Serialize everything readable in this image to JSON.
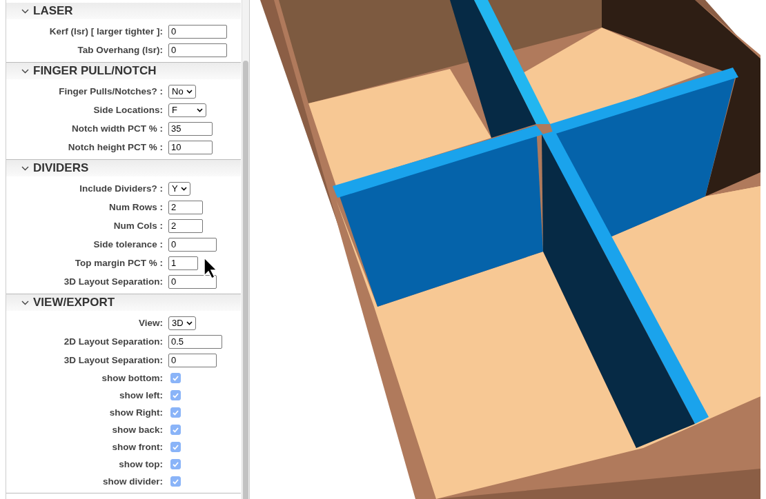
{
  "sections": [
    {
      "title": "LASER",
      "expanded": true,
      "fields": [
        {
          "kind": "text",
          "label": "Kerf (lsr) [ larger tighter ]:",
          "value": "0"
        },
        {
          "kind": "text",
          "label": "Tab Overhang (lsr):",
          "value": "0"
        }
      ]
    },
    {
      "title": "FINGER PULL/NOTCH",
      "expanded": true,
      "fields": [
        {
          "kind": "select",
          "label": "Finger Pulls/Notches? :",
          "value": "No"
        },
        {
          "kind": "select",
          "label": "Side Locations:",
          "value": "F"
        },
        {
          "kind": "text",
          "label": "Notch width PCT % :",
          "value": "35"
        },
        {
          "kind": "text",
          "label": "Notch height PCT % :",
          "value": "10"
        }
      ]
    },
    {
      "title": "DIVIDERS",
      "expanded": true,
      "fields": [
        {
          "kind": "select",
          "label": "Include Dividers? :",
          "value": "Y"
        },
        {
          "kind": "text",
          "label": "Num Rows :",
          "value": "2"
        },
        {
          "kind": "text",
          "label": "Num Cols :",
          "value": "2"
        },
        {
          "kind": "text",
          "label": "Side tolerance :",
          "value": "0"
        },
        {
          "kind": "text",
          "label": "Top margin PCT % :",
          "value": "1"
        },
        {
          "kind": "text",
          "label": "3D Layout Separation:",
          "value": "0"
        }
      ]
    },
    {
      "title": "VIEW/EXPORT",
      "expanded": true,
      "fields": [
        {
          "kind": "select",
          "label": "View:",
          "value": "3D"
        },
        {
          "kind": "text",
          "label": "2D Layout Separation:",
          "value": "0.5"
        },
        {
          "kind": "text",
          "label": "3D Layout Separation:",
          "value": "0"
        },
        {
          "kind": "checkbox",
          "label": "show bottom:",
          "checked": true
        },
        {
          "kind": "checkbox",
          "label": "show left:",
          "checked": true
        },
        {
          "kind": "checkbox",
          "label": "show Right:",
          "checked": true
        },
        {
          "kind": "checkbox",
          "label": "show back:",
          "checked": true
        },
        {
          "kind": "checkbox",
          "label": "show front:",
          "checked": true
        },
        {
          "kind": "checkbox",
          "label": "show top:",
          "checked": true
        },
        {
          "kind": "checkbox",
          "label": "show divider:",
          "checked": true
        }
      ]
    }
  ]
}
